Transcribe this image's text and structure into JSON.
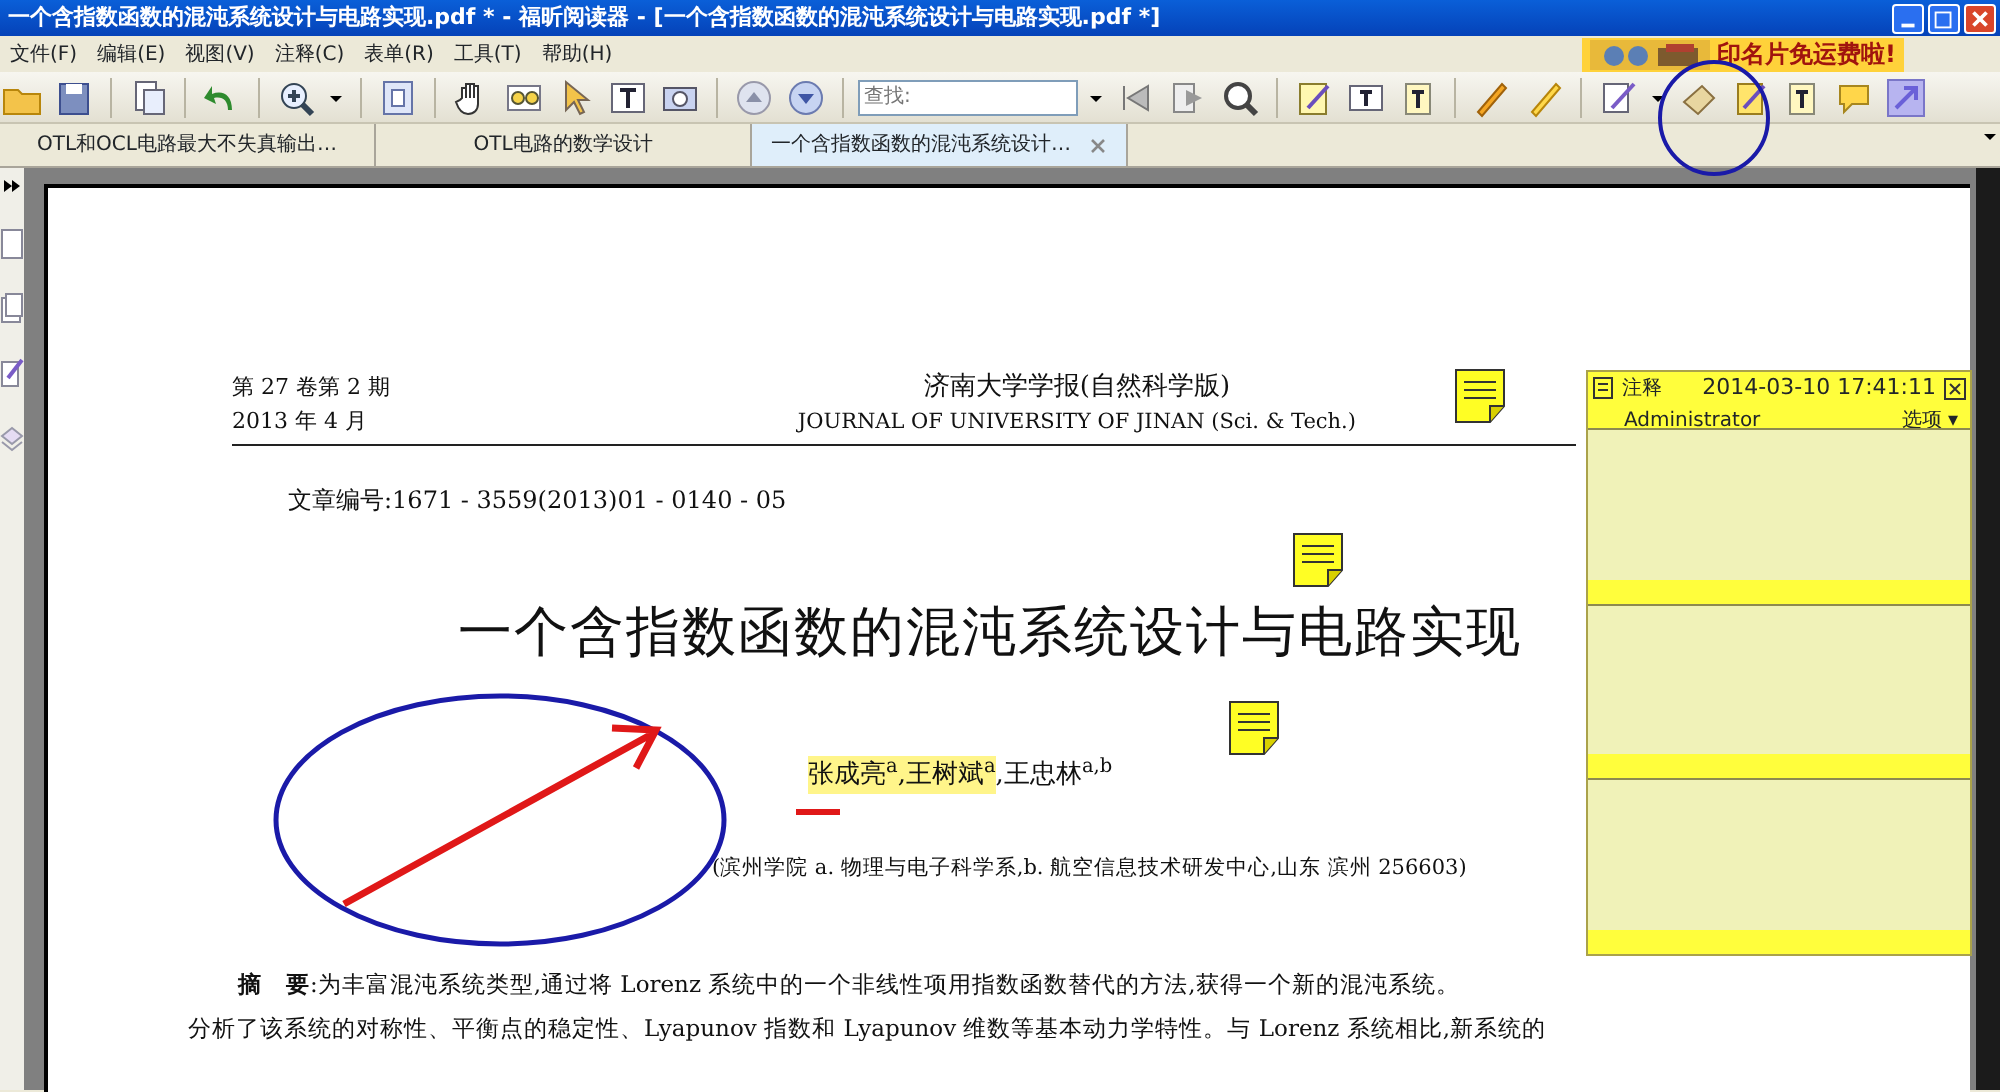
{
  "window": {
    "title": "一个含指数函数的混沌系统设计与电路实现.pdf * - 福昕阅读器 - [一个含指数函数的混沌系统设计与电路实现.pdf *]"
  },
  "menu": [
    "文件(F)",
    "编辑(E)",
    "视图(V)",
    "注释(C)",
    "表单(R)",
    "工具(T)",
    "帮助(H)"
  ],
  "ad": {
    "text": "印名片免运费啦!"
  },
  "search": {
    "placeholder": "查找:"
  },
  "tabs": [
    {
      "label": "OTL和OCL电路最大不失真输出…",
      "selected": false
    },
    {
      "label": "OTL电路的数学设计",
      "selected": false
    },
    {
      "label": "一个含指数函数的混沌系统设计…",
      "selected": true
    }
  ],
  "document": {
    "issue": "第 27 卷第 2 期",
    "date": "2013 年 4 月",
    "journal_cn": "济南大学学报(自然科学版)",
    "journal_en": "JOURNAL OF UNIVERSITY OF JINAN (Sci. & Tech.)",
    "article_no": "文章编号:1671 - 3559(2013)01 - 0140 - 05",
    "title": "一个含指数函数的混沌系统设计与电路实现",
    "authors": [
      {
        "text": "张成亮$^{a}$",
        "highlighted": true
      },
      {
        "text": ",王树斌$^{a}$",
        "highlighted": true
      },
      {
        "text": ",王忠林$^{a,b}$",
        "highlighted": false
      }
    ],
    "affiliation": "(滨州学院 a. 物理与电子科学系,b. 航空信息技术研发中心,山东 滨州 256603)",
    "abstract_label": "摘　要",
    "abstract_lines": [
      ":为丰富混沌系统类型,通过将 Lorenz 系统中的一个非线性项用指数函数替代的方法,获得一个新的混沌系统。",
      "分析了该系统的对称性、平衡点的稳定性、Lyapunov 指数和 Lyapunov 维数等基本动力学特性。与 Lorenz 系统相比,新系统的"
    ]
  },
  "note_popup": {
    "label": "注释",
    "timestamp": "2014-03-10 17:41:11",
    "author": "Administrator",
    "options": "选项 ▾"
  }
}
